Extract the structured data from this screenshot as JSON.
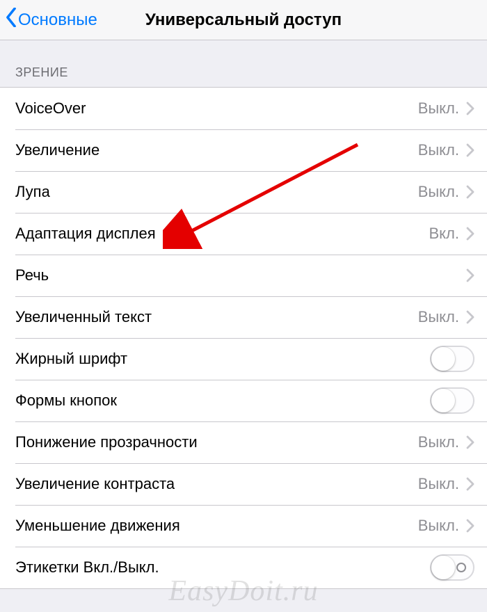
{
  "nav": {
    "back_label": "Основные",
    "title": "Универсальный доступ"
  },
  "section_header": "ЗРЕНИЕ",
  "rows": [
    {
      "label": "VoiceOver",
      "value": "Выкл.",
      "accessory": "chevron"
    },
    {
      "label": "Увеличение",
      "value": "Выкл.",
      "accessory": "chevron"
    },
    {
      "label": "Лупа",
      "value": "Выкл.",
      "accessory": "chevron"
    },
    {
      "label": "Адаптация дисплея",
      "value": "Вкл.",
      "accessory": "chevron"
    },
    {
      "label": "Речь",
      "value": "",
      "accessory": "chevron"
    },
    {
      "label": "Увеличенный текст",
      "value": "Выкл.",
      "accessory": "chevron"
    },
    {
      "label": "Жирный шрифт",
      "value": "",
      "accessory": "switch"
    },
    {
      "label": "Формы кнопок",
      "value": "",
      "accessory": "switch"
    },
    {
      "label": "Понижение прозрачности",
      "value": "Выкл.",
      "accessory": "chevron"
    },
    {
      "label": "Увеличение контраста",
      "value": "Выкл.",
      "accessory": "chevron"
    },
    {
      "label": "Уменьшение движения",
      "value": "Выкл.",
      "accessory": "chevron"
    },
    {
      "label": "Этикетки Вкл./Выкл.",
      "value": "",
      "accessory": "switch_labeled"
    }
  ],
  "watermark": "EasyDoit.ru"
}
